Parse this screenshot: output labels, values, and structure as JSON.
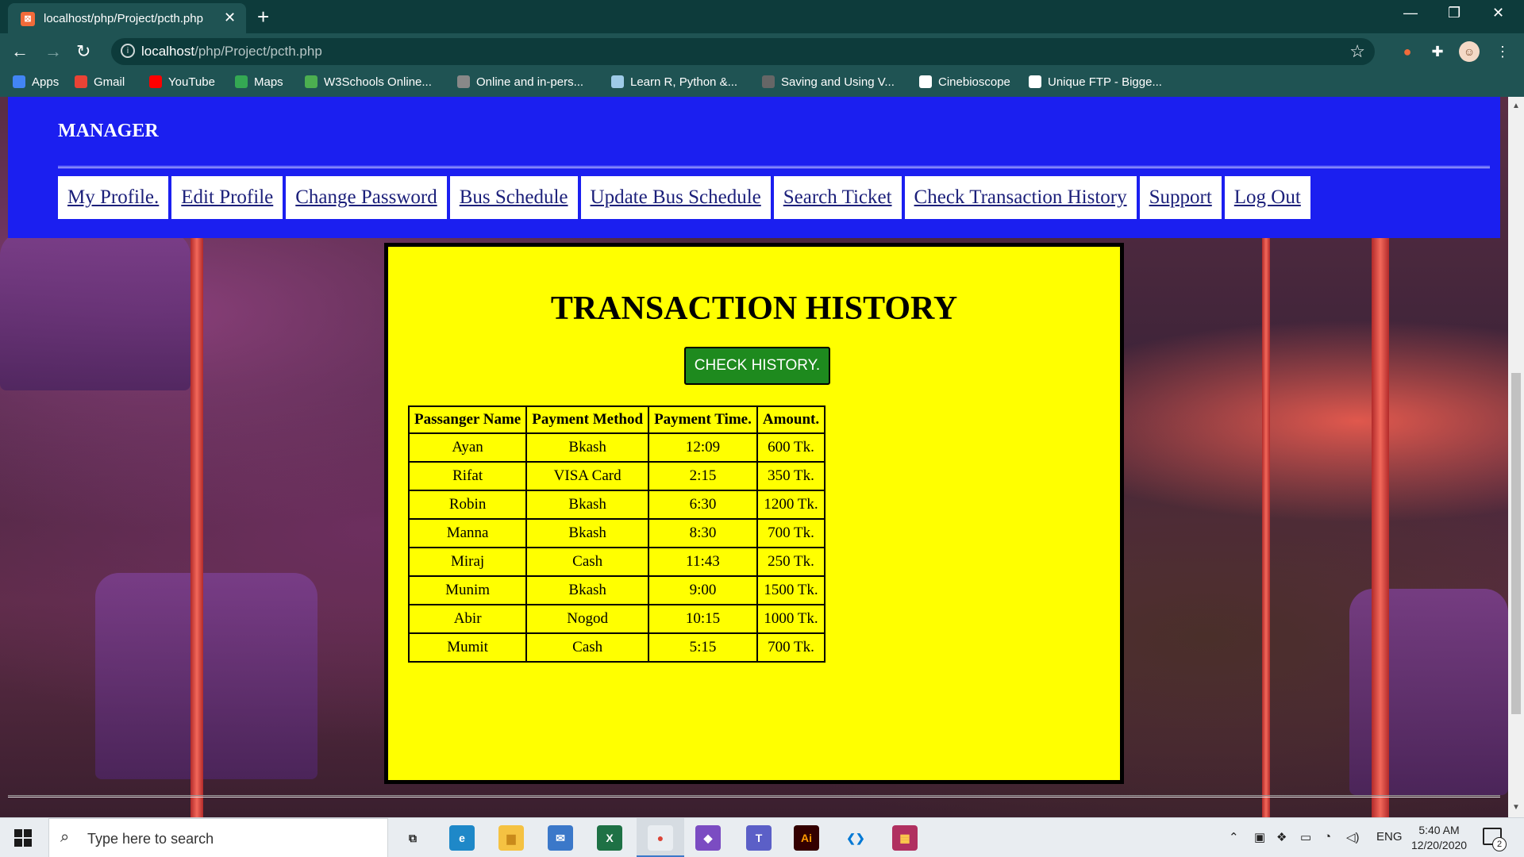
{
  "browser": {
    "tab_title": "localhost/php/Project/pcth.php",
    "tab_close": "✕",
    "new_tab": "+",
    "url_host": "localhost",
    "url_path": "/php/Project/pcth.php",
    "window_controls": {
      "minimize": "—",
      "restore": "❐",
      "close": "✕"
    },
    "nav": {
      "back": "←",
      "forward": "→",
      "reload": "↻"
    },
    "bookmarks": [
      {
        "label": "Apps",
        "color": "#4285f4"
      },
      {
        "label": "Gmail",
        "color": "#ea4335"
      },
      {
        "label": "YouTube",
        "color": "#ff0000"
      },
      {
        "label": "Maps",
        "color": "#34a853"
      },
      {
        "label": "W3Schools Online...",
        "color": "#4caf50"
      },
      {
        "label": "Online and in-pers...",
        "color": "#888888"
      },
      {
        "label": "Learn R, Python &...",
        "color": "#9ecbe8"
      },
      {
        "label": "Saving and Using V...",
        "color": "#666666"
      },
      {
        "label": "Cinebioscope",
        "color": "#ffffff"
      },
      {
        "label": "Unique FTP - Bigge...",
        "color": "#ffffff"
      }
    ]
  },
  "page": {
    "brand": "MANAGER",
    "nav_links": [
      "My Profile.",
      "Edit Profile",
      "Change Password",
      "Bus Schedule",
      "Update Bus Schedule",
      "Search Ticket",
      "Check Transaction History",
      "Support",
      "Log Out"
    ],
    "title": "TRANSACTION HISTORY",
    "check_button": "CHECK HISTORY.",
    "table": {
      "headers": [
        "Passanger Name",
        "Payment Method",
        "Payment Time.",
        "Amount."
      ],
      "rows": [
        [
          "Ayan",
          "Bkash",
          "12:09",
          "600 Tk."
        ],
        [
          "Rifat",
          "VISA Card",
          "2:15",
          "350 Tk."
        ],
        [
          "Robin",
          "Bkash",
          "6:30",
          "1200 Tk."
        ],
        [
          "Manna",
          "Bkash",
          "8:30",
          "700 Tk."
        ],
        [
          "Miraj",
          "Cash",
          "11:43",
          "250 Tk."
        ],
        [
          "Munim",
          "Bkash",
          "9:00",
          "1500 Tk."
        ],
        [
          "Abir",
          "Nogod",
          "10:15",
          "1000 Tk."
        ],
        [
          "Mumit",
          "Cash",
          "5:15",
          "700 Tk."
        ]
      ]
    },
    "colors": {
      "header_bg": "#1b1ff0",
      "card_bg": "#ffff00",
      "button_bg": "#1e8a1e"
    }
  },
  "taskbar": {
    "search_placeholder": "Type here to search",
    "language": "ENG",
    "time": "5:40 AM",
    "date": "12/20/2020",
    "notification_count": "2",
    "apps": [
      {
        "name": "task-view",
        "glyph": "⧉",
        "color": "#e9edf1",
        "fg": "#222222"
      },
      {
        "name": "edge",
        "glyph": "e",
        "color": "#1e88c8",
        "fg": "#ffffff"
      },
      {
        "name": "file-explorer",
        "glyph": "▆",
        "color": "#f5c242",
        "fg": "#c98a1a"
      },
      {
        "name": "mail",
        "glyph": "✉",
        "color": "#3b78c9",
        "fg": "#ffffff"
      },
      {
        "name": "excel",
        "glyph": "X",
        "color": "#1e7145",
        "fg": "#ffffff"
      },
      {
        "name": "chrome",
        "glyph": "●",
        "color": "#e9edf1",
        "fg": "#db4437"
      },
      {
        "name": "visual-studio",
        "glyph": "◆",
        "color": "#7b4cc2",
        "fg": "#ffffff"
      },
      {
        "name": "teams",
        "glyph": "T",
        "color": "#5b5fc7",
        "fg": "#ffffff"
      },
      {
        "name": "illustrator",
        "glyph": "Ai",
        "color": "#330000",
        "fg": "#ff9a00"
      },
      {
        "name": "vscode",
        "glyph": "❮❯",
        "color": "#e9edf1",
        "fg": "#0078d4"
      },
      {
        "name": "winrar",
        "glyph": "▦",
        "color": "#b03060",
        "fg": "#ffd24a"
      }
    ]
  }
}
